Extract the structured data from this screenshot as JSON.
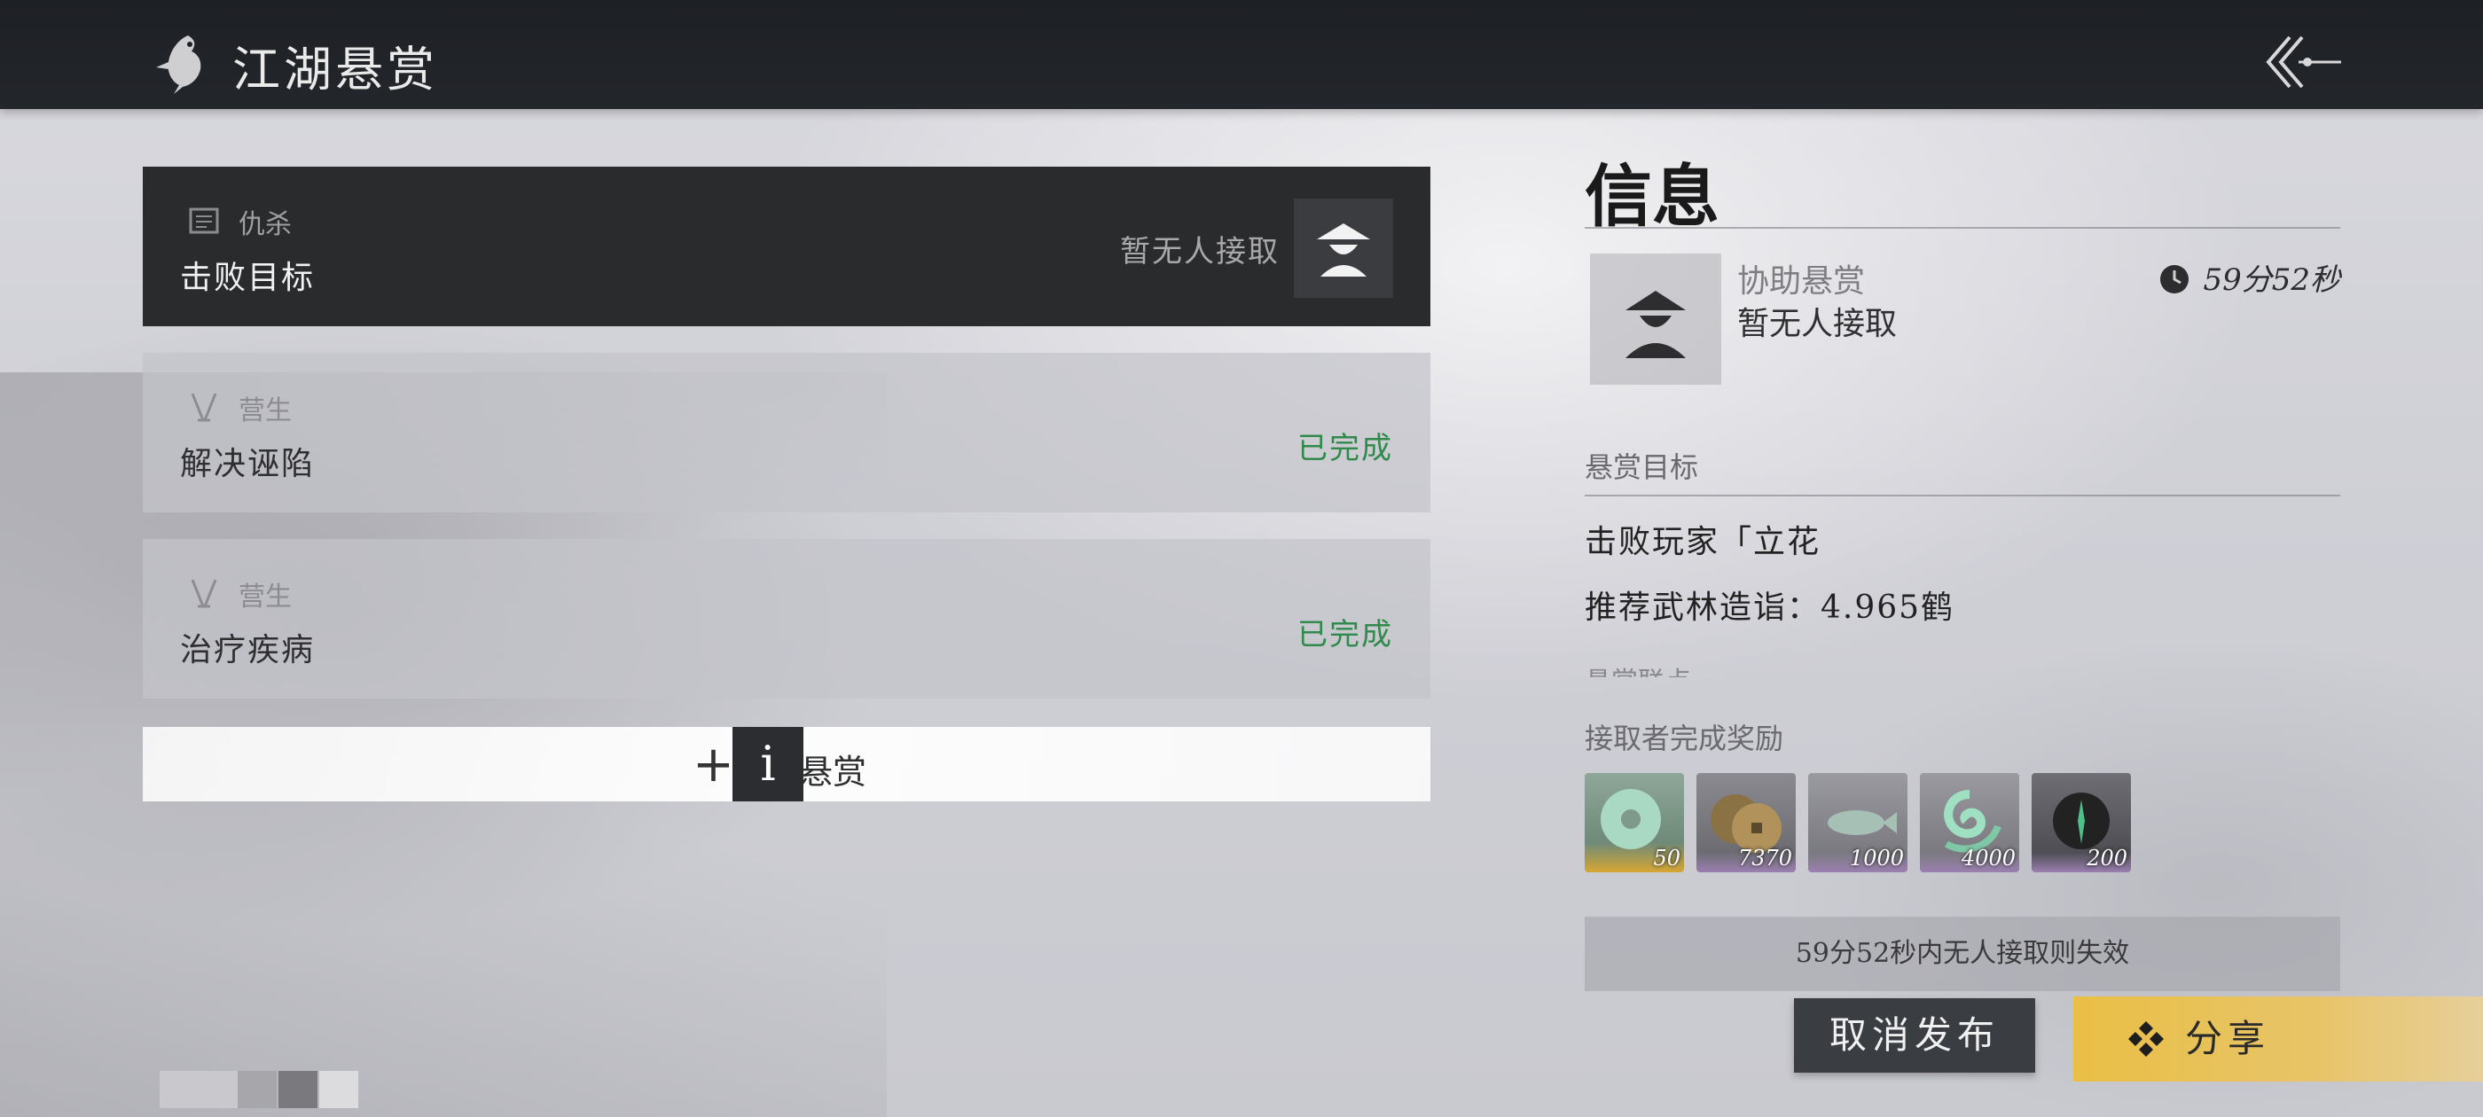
{
  "header": {
    "title": "江湖悬赏",
    "icons": [
      "bird-icon",
      "back-arrow-icon"
    ]
  },
  "tasks": [
    {
      "type": "仇杀",
      "name": "击败目标",
      "status": "暂无人接取",
      "icon": "scroll-icon",
      "active": true
    },
    {
      "type": "营生",
      "name": "解决诬陷",
      "status": "已完成",
      "icon": "tools-icon"
    },
    {
      "type": "营生",
      "name": "治疗疾病",
      "status": "已完成",
      "icon": "tools-icon"
    }
  ],
  "add_bar": {
    "plus": "+",
    "label": "悬赏",
    "info": "i"
  },
  "info": {
    "title": "信息",
    "poster": {
      "type": "协助悬赏",
      "status": "暂无人接取",
      "timer": "59分52秒"
    },
    "target_label": "悬赏目标",
    "target_lines": [
      "击败玩家「立花",
      "推荐武林造诣：4.965鹤"
    ],
    "clipped_label": "悬赏联点",
    "rewards_label": "接取者完成奖励",
    "rewards": [
      {
        "icon": "jade-disc-icon",
        "qty": "50"
      },
      {
        "icon": "coins-icon",
        "qty": "7370"
      },
      {
        "icon": "fish-icon",
        "qty": "1000"
      },
      {
        "icon": "swirl-icon",
        "qty": "4000"
      },
      {
        "icon": "dark-orb-icon",
        "qty": "200"
      }
    ],
    "expire_text": "59分52秒内无人接取则失效"
  },
  "buttons": {
    "cancel": "取消发布",
    "share": "分享"
  },
  "colors": {
    "complete_green": "#2f8a4b",
    "share_gold": "#e9bf45",
    "topbar": "#1d2024"
  }
}
